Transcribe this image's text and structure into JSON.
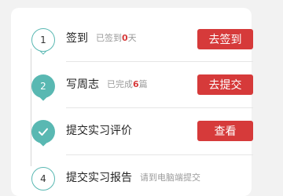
{
  "steps": [
    {
      "number": "1",
      "title": "签到",
      "sub_prefix": "已签到",
      "sub_count": "0",
      "sub_suffix": "天",
      "button": "去签到",
      "marker": "outline"
    },
    {
      "number": "2",
      "title": "写周志",
      "sub_prefix": "已完成",
      "sub_count": "6",
      "sub_suffix": "篇",
      "button": "去提交",
      "marker": "filled"
    },
    {
      "number": "",
      "icon": "check-icon",
      "title": "提交实习评价",
      "button": "查看",
      "marker": "filled"
    },
    {
      "number": "4",
      "title": "提交实习报告",
      "sub_text": "请到电脑端提交",
      "marker": "outline"
    }
  ],
  "colors": {
    "accent": "#59b8b2",
    "button": "#d63a3a",
    "count": "#d63a3a"
  }
}
